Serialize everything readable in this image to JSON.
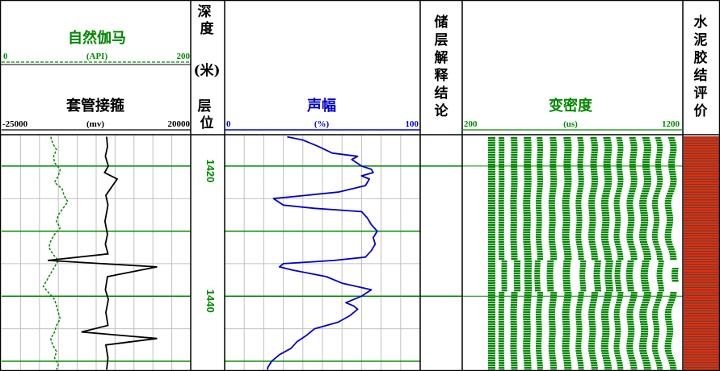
{
  "colors": {
    "green": "#008800",
    "blue": "#0000cc",
    "black": "#000000",
    "grid": "#c0c0c0",
    "cement_fill": "#e03010",
    "cement_line": "#404040"
  },
  "tracks": {
    "sp": {
      "title": "自然伽马",
      "unit": "(API)",
      "min": "0",
      "max": "200"
    },
    "ccl": {
      "title": "套管接箍",
      "unit": "(mv)",
      "min": "-25000",
      "max": "20000"
    },
    "depth": {
      "title_top": "深度",
      "title_unit": "(米)",
      "title_bottom": "层位"
    },
    "amp": {
      "title": "声幅",
      "unit": "(%)",
      "min": "0",
      "max": "100"
    },
    "reservoir": {
      "title": "储层解释结论"
    },
    "vdl": {
      "title": "变密度",
      "unit": "(us)",
      "min": "200",
      "max": "1200"
    },
    "cement": {
      "title": "水泥胶结评价"
    }
  },
  "chart_data": {
    "type": "line",
    "y_axis": {
      "name": "depth",
      "unit": "m",
      "range": [
        1415.3,
        1451.5
      ],
      "major_ticks": [
        1420,
        1440
      ],
      "tick_labels": [
        "1420",
        "1440"
      ]
    },
    "series": [
      {
        "name": "自然伽马",
        "x_range": [
          0,
          200
        ],
        "depth": [
          1415.5,
          1416.5,
          1417.5,
          1418.5,
          1419.5,
          1420.5,
          1421.5,
          1422.5,
          1423.5,
          1424.5,
          1425.5,
          1426.5,
          1427.5,
          1428.5,
          1429.5,
          1430.5,
          1431.5,
          1432.5,
          1433.5,
          1434.5,
          1435.5,
          1436.5,
          1437.5,
          1438.5,
          1439.5,
          1440.5,
          1441.5,
          1442.5,
          1443.5,
          1444.5,
          1445.5,
          1446.5,
          1447.5,
          1448.5,
          1449.5,
          1450.5,
          1451.3
        ],
        "values": [
          52,
          54,
          58,
          55,
          56,
          62,
          60,
          56,
          64,
          66,
          70,
          65,
          60,
          58,
          62,
          56,
          52,
          50,
          54,
          60,
          56,
          52,
          48,
          44,
          50,
          56,
          58,
          60,
          62,
          58,
          56,
          52,
          54,
          58,
          56,
          60,
          58
        ]
      },
      {
        "name": "套管接箍",
        "x_range": [
          -25000,
          20000
        ],
        "depth": [
          1415.5,
          1417.0,
          1418.5,
          1420.0,
          1421.0,
          1422.0,
          1424.5,
          1426.0,
          1428.5,
          1430.5,
          1432.0,
          1433.5,
          1434.5,
          1435.5,
          1437.0,
          1439.0,
          1440.5,
          1442.5,
          1444.5,
          1445.5,
          1446.5,
          1447.5,
          1449.5,
          1451.3
        ],
        "values": [
          0,
          200,
          -300,
          400,
          -500,
          2500,
          -200,
          300,
          -400,
          200,
          -300,
          300,
          -14000,
          12000,
          200,
          -300,
          400,
          -200,
          300,
          -6000,
          12000,
          -200,
          300,
          0
        ]
      },
      {
        "name": "声幅",
        "x_range": [
          0,
          100
        ],
        "depth": [
          1415.5,
          1416.0,
          1417.0,
          1418.0,
          1418.5,
          1419.0,
          1420.0,
          1420.5,
          1421.0,
          1421.5,
          1422.0,
          1423.0,
          1424.0,
          1425.0,
          1426.0,
          1426.5,
          1427.0,
          1428.0,
          1429.0,
          1430.0,
          1431.0,
          1432.0,
          1433.0,
          1434.0,
          1434.5,
          1435.0,
          1435.5,
          1436.0,
          1437.0,
          1438.0,
          1439.0,
          1440.0,
          1441.0,
          1441.5,
          1442.0,
          1443.0,
          1444.0,
          1445.0,
          1446.0,
          1447.0,
          1448.0,
          1449.0,
          1450.0,
          1451.0,
          1451.3
        ],
        "values": [
          32,
          40,
          48,
          55,
          68,
          65,
          70,
          75,
          76,
          70,
          74,
          72,
          58,
          25,
          30,
          46,
          70,
          73,
          75,
          78,
          76,
          77,
          75,
          72,
          56,
          30,
          28,
          35,
          52,
          60,
          75,
          70,
          62,
          66,
          68,
          64,
          58,
          46,
          42,
          37,
          34,
          28,
          24,
          22,
          22
        ]
      }
    ]
  }
}
